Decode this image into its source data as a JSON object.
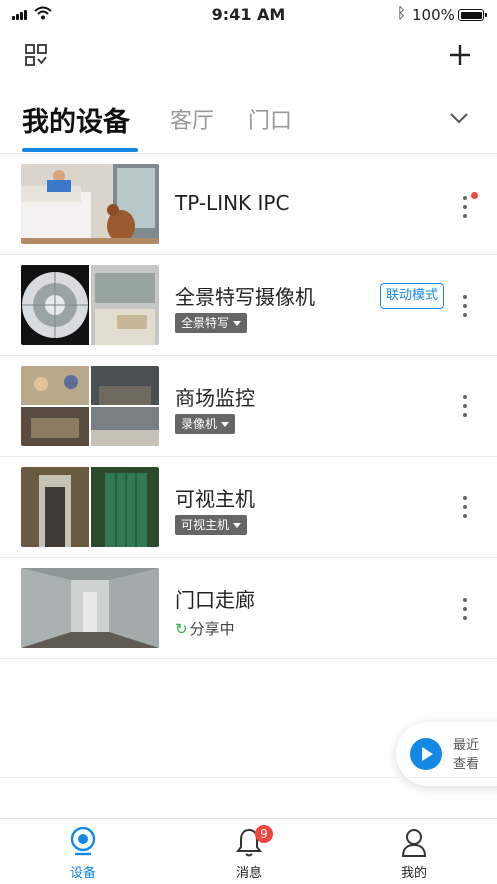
{
  "status_bar": {
    "time": "9:41 AM",
    "battery": "100%"
  },
  "tabs": [
    {
      "label": "我的设备",
      "active": true
    },
    {
      "label": "客厅",
      "active": false
    },
    {
      "label": "门口",
      "active": false
    }
  ],
  "devices": [
    {
      "name": "TP-LINK IPC",
      "has_new": true
    },
    {
      "name": "全景特写摄像机",
      "tag": "全景特写",
      "mode_button": "联动模式"
    },
    {
      "name": "商场监控",
      "tag": "录像机"
    },
    {
      "name": "可视主机",
      "tag": "可视主机"
    },
    {
      "name": "门口走廊",
      "status": "分享中"
    }
  ],
  "recent": {
    "label_line1": "最近",
    "label_line2": "查看"
  },
  "bottom_nav": [
    {
      "label": "设备",
      "icon": "camera-icon",
      "active": true
    },
    {
      "label": "消息",
      "icon": "bell-icon",
      "badge": "9"
    },
    {
      "label": "我的",
      "icon": "user-icon"
    }
  ],
  "colors": {
    "accent": "#1488e6",
    "badge_red": "#f2453d",
    "share_green": "#2bb24c"
  }
}
